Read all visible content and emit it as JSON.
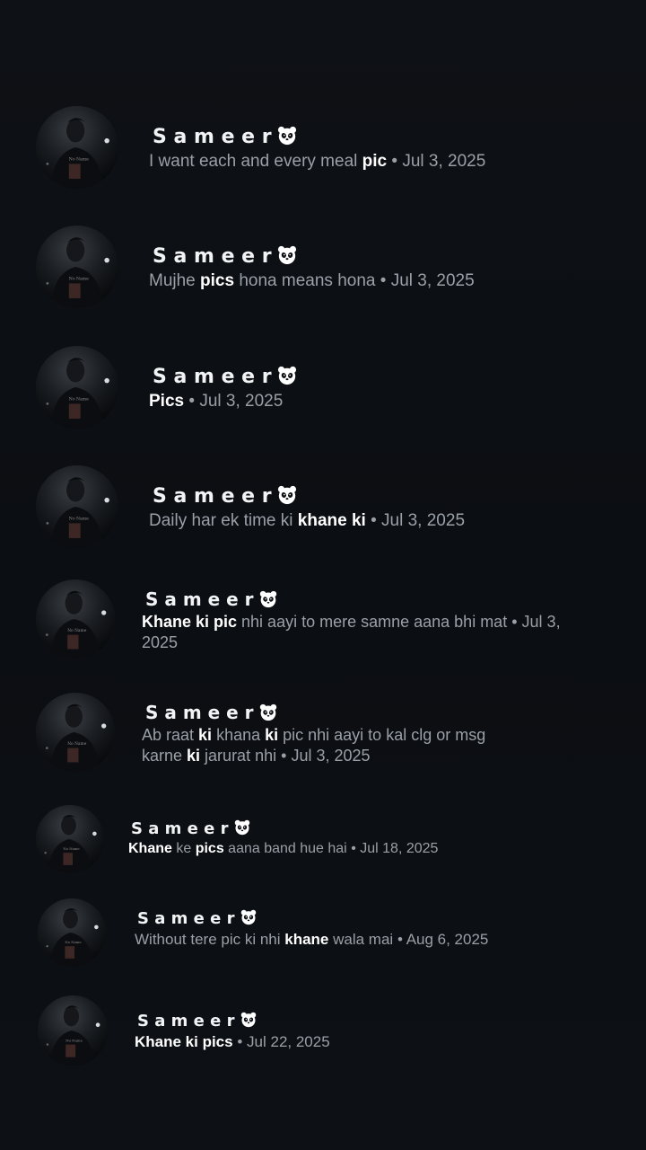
{
  "results": [
    {
      "name": "S a m e e r",
      "pre": "I want each and every meal ",
      "hl": "pic",
      "post": "",
      "date": "Jul 3, 2025"
    },
    {
      "name": "S a m e e r",
      "pre": "Mujhe ",
      "hl": "pics",
      "post": " hona means hona",
      "date": "Jul 3, 2025"
    },
    {
      "name": "S a m e e r",
      "pre": "",
      "hl": "Pics",
      "post": "",
      "date": "Jul 3, 2025"
    },
    {
      "name": "S a m e e r",
      "pre": "Daily har ek time ki ",
      "hl": "khane ki",
      "post": "",
      "date": "Jul 3, 2025"
    },
    {
      "name": "S a m e e r",
      "pre": "",
      "hl": "Khane ki pic",
      "post": " nhi aayi to mere samne aana bhi mat",
      "date": "Jul 3, 2025"
    },
    {
      "name": "S a m e e r",
      "pre": "Ab raat ",
      "hl": "ki",
      "post": " khana ",
      "hl2": "ki",
      "post2": " pic nhi aayi to kal clg or msg karne ",
      "hl3": "ki",
      "post3": " jarurat nhi",
      "date": "Jul 3, 2025"
    },
    {
      "name": "S a m e e r",
      "pre": "",
      "hl": "Khane",
      "post": " ke ",
      "hl2": "pics",
      "post2": " aana band hue hai",
      "date": "Jul 18, 2025"
    },
    {
      "name": "S a m e e r",
      "pre": "Without tere pic ki nhi ",
      "hl": "khane",
      "post": " wala mai",
      "date": "Aug 6, 2025"
    },
    {
      "name": "S a m e e r",
      "pre": "",
      "hl": "Khane ki pics",
      "post": "",
      "date": "Jul 22, 2025"
    }
  ],
  "separator": "•",
  "icons": {
    "avatar": "profile-photo",
    "name_suffix": "panda-emoji-icon"
  }
}
